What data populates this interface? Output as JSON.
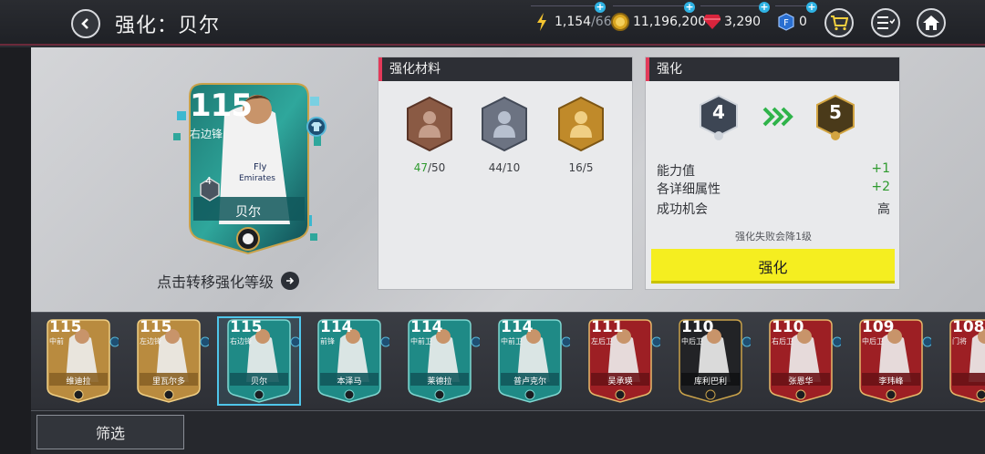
{
  "header": {
    "title": "强化：贝尔",
    "energy": "1,154",
    "energy_max": "/66",
    "coins": "11,196,200",
    "gems": "3,290",
    "fifa_points": "0"
  },
  "player_card": {
    "ovr": "115",
    "position": "右边锋",
    "name": "贝尔",
    "rank": "4",
    "team_line1": "Fly",
    "team_line2": "Emirates"
  },
  "transfer_label": "点击转移强化等级",
  "materials": {
    "header": "强化材料",
    "items": [
      {
        "have": "47",
        "need": "/50",
        "tier": "bronze"
      },
      {
        "have": "44/10",
        "tier": "silver"
      },
      {
        "have": "16/5",
        "tier": "gold"
      }
    ]
  },
  "enhance": {
    "header": "强化",
    "from_rank": "4",
    "to_rank": "5",
    "stats": [
      {
        "label": "能力值",
        "value": "+1"
      },
      {
        "label": "各详细属性",
        "value": "+2"
      },
      {
        "label": "成功机会",
        "value": "高"
      }
    ],
    "warning": "强化失败会降1级",
    "button_label": "强化"
  },
  "strip_cards": [
    {
      "ovr": "115",
      "pos": "中前",
      "name": "维迪拉",
      "style": "gold"
    },
    {
      "ovr": "115",
      "pos": "左边锋",
      "name": "里瓦尔多",
      "style": "gold"
    },
    {
      "ovr": "115",
      "pos": "右边锋",
      "name": "贝尔",
      "style": "teal",
      "selected": true
    },
    {
      "ovr": "114",
      "pos": "前锋",
      "name": "本泽马",
      "style": "teal"
    },
    {
      "ovr": "114",
      "pos": "中前卫",
      "name": "莱德拉",
      "style": "teal"
    },
    {
      "ovr": "114",
      "pos": "中前卫",
      "name": "普卢克尔",
      "style": "teal"
    },
    {
      "ovr": "111",
      "pos": "左后卫",
      "name": "吴承瑛",
      "style": "red"
    },
    {
      "ovr": "110",
      "pos": "中后卫",
      "name": "库利巴利",
      "style": "black"
    },
    {
      "ovr": "110",
      "pos": "右后卫",
      "name": "张恩华",
      "style": "red"
    },
    {
      "ovr": "109",
      "pos": "中后卫",
      "name": "李玮峰",
      "style": "red"
    },
    {
      "ovr": "108",
      "pos": "门将",
      "name": "",
      "style": "red"
    }
  ],
  "filter_label": "筛选",
  "colors": {
    "accent": "#e23a5a",
    "button": "#f5ee20",
    "positive": "#2e9a2e"
  }
}
